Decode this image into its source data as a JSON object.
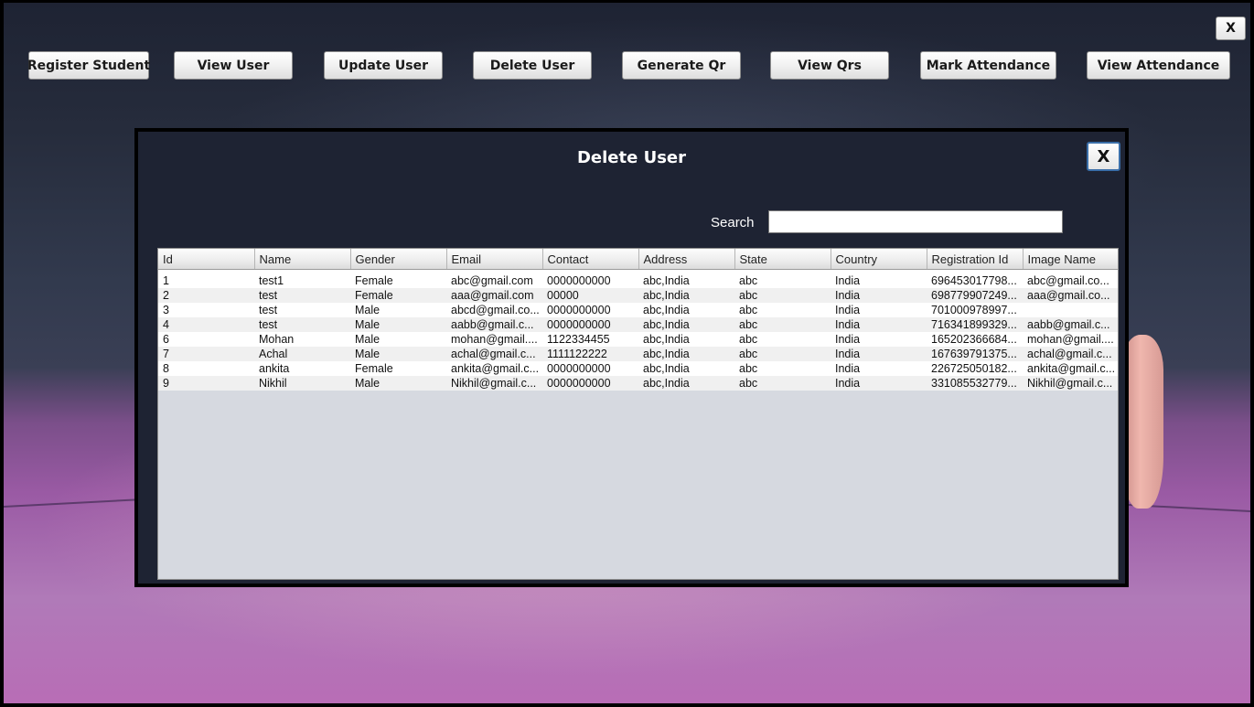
{
  "window": {
    "close_label": "X"
  },
  "menu": {
    "buttons": [
      {
        "label": "Register Student"
      },
      {
        "label": "View User"
      },
      {
        "label": "Update User"
      },
      {
        "label": "Delete User"
      },
      {
        "label": "Generate Qr"
      },
      {
        "label": "View Qrs"
      },
      {
        "label": "Mark Attendance"
      },
      {
        "label": "View Attendance"
      }
    ]
  },
  "dialog": {
    "title": "Delete User",
    "close_label": "X",
    "search": {
      "label": "Search",
      "value": "",
      "placeholder": ""
    },
    "table": {
      "columns": [
        "Id",
        "Name",
        "Gender",
        "Email",
        "Contact",
        "Address",
        "State",
        "Country",
        "Registration Id",
        "Image Name"
      ],
      "rows": [
        [
          "1",
          "test1",
          "Female",
          "abc@gmail.com",
          "0000000000",
          "abc,India",
          "abc",
          "India",
          "696453017798...",
          "abc@gmail.co..."
        ],
        [
          "2",
          "test",
          "Female",
          "aaa@gmail.com",
          "00000",
          "abc,India",
          "abc",
          "India",
          "698779907249...",
          "aaa@gmail.co..."
        ],
        [
          "3",
          "test",
          "Male",
          "abcd@gmail.co...",
          "0000000000",
          "abc,India",
          "abc",
          "India",
          "701000978997...",
          ""
        ],
        [
          "4",
          "test",
          "Male",
          "aabb@gmail.c...",
          "0000000000",
          "abc,India",
          "abc",
          "India",
          "716341899329...",
          "aabb@gmail.c..."
        ],
        [
          "6",
          "Mohan",
          "Male",
          "mohan@gmail....",
          "1122334455",
          "abc,India",
          "abc",
          "India",
          "165202366684...",
          "mohan@gmail...."
        ],
        [
          "7",
          "Achal",
          "Male",
          "achal@gmail.c...",
          "1111122222",
          "abc,India",
          "abc",
          "India",
          "167639791375...",
          "achal@gmail.c..."
        ],
        [
          "8",
          "ankita",
          "Female",
          "ankita@gmail.c...",
          "0000000000",
          "abc,India",
          "abc",
          "India",
          "226725050182...",
          "ankita@gmail.c..."
        ],
        [
          "9",
          "Nikhil",
          "Male",
          "Nikhil@gmail.c...",
          "0000000000",
          "abc,India",
          "abc",
          "India",
          "331085532779...",
          "Nikhil@gmail.c..."
        ]
      ]
    }
  }
}
